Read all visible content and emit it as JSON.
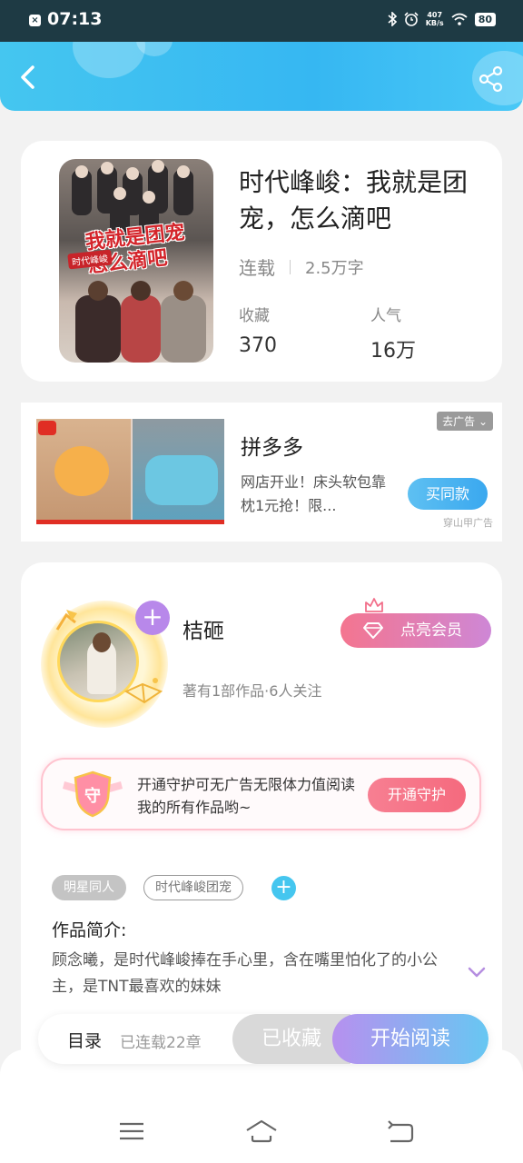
{
  "status_bar": {
    "time": "07:13",
    "net_speed_value": "407",
    "net_speed_unit": "KB/s",
    "battery": "80",
    "icons": [
      "bluetooth-icon",
      "alarm-icon",
      "wifi-icon",
      "battery-icon"
    ]
  },
  "header": {
    "back_icon": "chevron-left-icon",
    "share_icon": "share-icon",
    "gradient_colors": [
      "#45c6f0",
      "#36b7f2"
    ]
  },
  "book": {
    "title": "时代峰峻：我就是团宠，怎么滴吧",
    "cover_title": "我就是团宠怎么滴吧",
    "cover_badge": "时代峰峻",
    "status": "连载",
    "word_count": "2.5万字",
    "favorites_label": "收藏",
    "favorites_value": "370",
    "popularity_label": "人气",
    "popularity_value": "16万"
  },
  "ad": {
    "brand": "拼多多",
    "description": "网店开业！床头软包靠枕1元抢！限...",
    "button_label": "买同款",
    "close_label": "去广告",
    "source": "穿山甲广告"
  },
  "author": {
    "name": "桔砸",
    "info": "著有1部作品·6人关注",
    "vip_button": "点亮会员",
    "guard_text": "开通守护可无广告无限体力值阅读我的所有作品哟~",
    "guard_shield_label": "守",
    "guard_button": "开通守护"
  },
  "tags": [
    "明星同人",
    "时代峰峻团宠"
  ],
  "intro": {
    "title": "作品简介:",
    "text": "顾念曦，是时代峰峻捧在手心里，含在嘴里怕化了的小公主，是TNT最喜欢的妹妹"
  },
  "actions": {
    "toc_label": "目录",
    "chapter_count": "已连载22章",
    "favorited_label": "已收藏",
    "read_label": "开始阅读"
  },
  "nav": {
    "icons": [
      "menu-icon",
      "home-icon",
      "back-icon"
    ]
  }
}
